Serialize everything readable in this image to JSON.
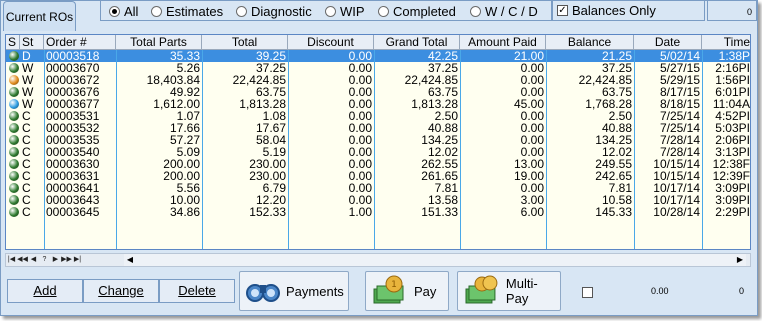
{
  "tab": "Current ROs",
  "filters": [
    {
      "label": "All",
      "selected": true
    },
    {
      "label": "Estimates",
      "selected": false
    },
    {
      "label": "Diagnostic",
      "selected": false
    },
    {
      "label": "WIP",
      "selected": false
    },
    {
      "label": "Completed",
      "selected": false
    },
    {
      "label": "W / C / D",
      "selected": false
    }
  ],
  "balances_only": {
    "label": "Balances Only",
    "checked": true
  },
  "top_right_value": "0",
  "columns": [
    "S",
    "St",
    "Order #",
    "Total Parts",
    "Total",
    "Discount",
    "Grand Total",
    "Amount Paid",
    "Balance",
    "Date",
    "Time"
  ],
  "rows": [
    {
      "status_color": "#2e7a2e",
      "st": "D",
      "order": "00003518",
      "parts": "35.33",
      "total": "39.25",
      "discount": "0.00",
      "grand": "42.25",
      "paid": "21.00",
      "balance": "21.25",
      "date": "5/02/14",
      "time": "1:38P",
      "selected": true
    },
    {
      "status_color": "#2e7a2e",
      "st": "W",
      "order": "00003670",
      "parts": "5.26",
      "total": "37.25",
      "discount": "0.00",
      "grand": "37.25",
      "paid": "0.00",
      "balance": "37.25",
      "date": "5/27/15",
      "time": "2:16PI",
      "selected": false
    },
    {
      "status_color": "#e08a1a",
      "st": "W",
      "order": "00003672",
      "parts": "18,403.84",
      "total": "22,424.85",
      "discount": "0.00",
      "grand": "22,424.85",
      "paid": "0.00",
      "balance": "22,424.85",
      "date": "5/29/15",
      "time": "1:56PI",
      "selected": false
    },
    {
      "status_color": "#2e7a2e",
      "st": "W",
      "order": "00003676",
      "parts": "49.92",
      "total": "63.75",
      "discount": "0.00",
      "grand": "63.75",
      "paid": "0.00",
      "balance": "63.75",
      "date": "8/17/15",
      "time": "6:01PI",
      "selected": false
    },
    {
      "status_color": "#2a9ae0",
      "st": "W",
      "order": "00003677",
      "parts": "1,612.00",
      "total": "1,813.28",
      "discount": "0.00",
      "grand": "1,813.28",
      "paid": "45.00",
      "balance": "1,768.28",
      "date": "8/18/15",
      "time": "11:04A",
      "selected": false
    },
    {
      "status_color": "#2e7a2e",
      "st": "C",
      "order": "00003531",
      "parts": "1.07",
      "total": "1.08",
      "discount": "0.00",
      "grand": "2.50",
      "paid": "0.00",
      "balance": "2.50",
      "date": "7/25/14",
      "time": "4:52PI",
      "selected": false
    },
    {
      "status_color": "#2e7a2e",
      "st": "C",
      "order": "00003532",
      "parts": "17.66",
      "total": "17.67",
      "discount": "0.00",
      "grand": "40.88",
      "paid": "0.00",
      "balance": "40.88",
      "date": "7/25/14",
      "time": "5:03PI",
      "selected": false
    },
    {
      "status_color": "#2e7a2e",
      "st": "C",
      "order": "00003535",
      "parts": "57.27",
      "total": "58.04",
      "discount": "0.00",
      "grand": "134.25",
      "paid": "0.00",
      "balance": "134.25",
      "date": "7/28/14",
      "time": "2:06PI",
      "selected": false
    },
    {
      "status_color": "#2e7a2e",
      "st": "C",
      "order": "00003540",
      "parts": "5.09",
      "total": "5.19",
      "discount": "0.00",
      "grand": "12.02",
      "paid": "0.00",
      "balance": "12.02",
      "date": "7/28/14",
      "time": "3:13PI",
      "selected": false
    },
    {
      "status_color": "#2e7a2e",
      "st": "C",
      "order": "00003630",
      "parts": "200.00",
      "total": "230.00",
      "discount": "0.00",
      "grand": "262.55",
      "paid": "13.00",
      "balance": "249.55",
      "date": "10/15/14",
      "time": "12:38F",
      "selected": false
    },
    {
      "status_color": "#2e7a2e",
      "st": "C",
      "order": "00003631",
      "parts": "200.00",
      "total": "230.00",
      "discount": "0.00",
      "grand": "261.65",
      "paid": "19.00",
      "balance": "242.65",
      "date": "10/15/14",
      "time": "12:39F",
      "selected": false
    },
    {
      "status_color": "#2e7a2e",
      "st": "C",
      "order": "00003641",
      "parts": "5.56",
      "total": "6.79",
      "discount": "0.00",
      "grand": "7.81",
      "paid": "0.00",
      "balance": "7.81",
      "date": "10/17/14",
      "time": "3:09PI",
      "selected": false
    },
    {
      "status_color": "#2e7a2e",
      "st": "C",
      "order": "00003643",
      "parts": "10.00",
      "total": "12.20",
      "discount": "0.00",
      "grand": "13.58",
      "paid": "3.00",
      "balance": "10.58",
      "date": "10/17/14",
      "time": "3:09PI",
      "selected": false
    },
    {
      "status_color": "#2e7a2e",
      "st": "C",
      "order": "00003645",
      "parts": "34.86",
      "total": "152.33",
      "discount": "1.00",
      "grand": "151.33",
      "paid": "6.00",
      "balance": "145.33",
      "date": "10/28/14",
      "time": "2:29PI",
      "selected": false
    }
  ],
  "nav_buttons": [
    "|◀",
    "◀◀",
    "◀",
    "?",
    "▶",
    "▶▶",
    "▶|"
  ],
  "buttons": {
    "add": "Add",
    "change": "Change",
    "delete": "Delete",
    "payments": "Payments",
    "pay": "Pay",
    "multipay": "Multi-Pay"
  },
  "bottom_value": "0.00",
  "bottom_right_value": "0"
}
